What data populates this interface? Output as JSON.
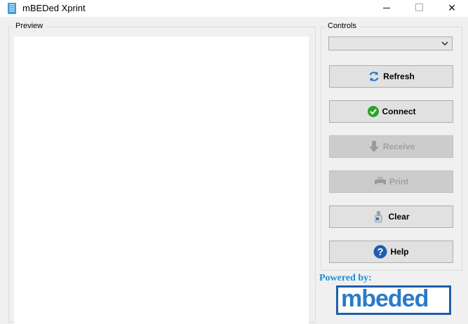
{
  "window": {
    "title": "mBEDed Xprint",
    "minimize_glyph": "—",
    "close_glyph": "✕"
  },
  "preview": {
    "label": "Preview"
  },
  "controls": {
    "label": "Controls",
    "port_select_value": "",
    "buttons": {
      "refresh": {
        "label": "Refresh",
        "enabled": true,
        "icon": "refresh-icon"
      },
      "connect": {
        "label": "Connect",
        "enabled": true,
        "icon": "check-circle-icon"
      },
      "receive": {
        "label": "Receive",
        "enabled": false,
        "icon": "download-arrow-icon"
      },
      "print": {
        "label": "Print",
        "enabled": false,
        "icon": "printer-icon"
      },
      "clear": {
        "label": "Clear",
        "enabled": true,
        "icon": "eraser-icon"
      },
      "help": {
        "label": "Help",
        "enabled": true,
        "icon": "question-circle-icon"
      }
    }
  },
  "branding": {
    "powered_by": "Powered by:",
    "logo_text": "mbeded"
  },
  "colors": {
    "accent_blue": "#1b8fd0",
    "logo_border": "#1f5fa8",
    "connect_green": "#2aa52a",
    "help_blue": "#1b5fb0"
  }
}
